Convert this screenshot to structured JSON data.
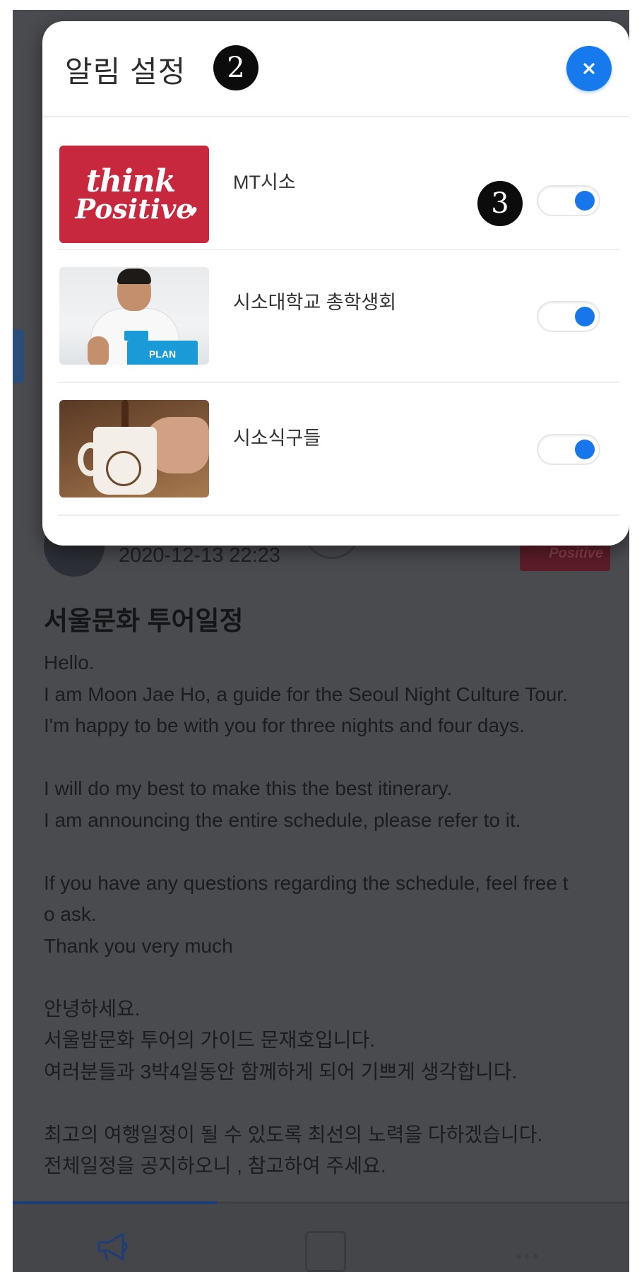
{
  "modal": {
    "title": "알림 설정",
    "step_badge_title": "2",
    "close_icon": "close-icon",
    "items": [
      {
        "label": "MT시소",
        "thumbnail": "think positive",
        "enabled": true,
        "step_badge": "3"
      },
      {
        "label": "시소대학교 총학생회",
        "thumbnail": "PLAN",
        "enabled": true
      },
      {
        "label": "시소식구들",
        "thumbnail": "coffee-mug-photo",
        "enabled": true
      }
    ]
  },
  "background_post": {
    "date": "2020-12-13 22:23",
    "thumbnail_text": "Positive",
    "title": "서울문화 투어일정",
    "body_lines": [
      "Hello.",
      "I am Moon Jae Ho, a guide for the Seoul Night Culture Tour.",
      "I'm happy to be with you for three nights and four days.",
      "",
      "I will do my best to make this the best itinerary.",
      "I am announcing the entire schedule, please refer to it.",
      "",
      "If you have any questions regarding the schedule, feel free t",
      "o ask.",
      "Thank you very much",
      "",
      "안녕하세요.",
      "서울밤문화 투어의 가이드 문재호입니다.",
      "여러분들과 3박4일동안 함께하게 되어 기쁘게 생각합니다.",
      "",
      "최고의 여행일정이 될 수 있도록 최선의 노력을 다하겠습니다.",
      "전체일정을 공지하오니 , 참고하여 주세요."
    ]
  },
  "thumbnails": {
    "positive_line1": "think",
    "positive_line2": "Positive",
    "plan_text": "PLAN"
  },
  "colors": {
    "accent": "#1679ec",
    "overlay": "#4a4b4f",
    "thumb_red": "#c8283d"
  }
}
